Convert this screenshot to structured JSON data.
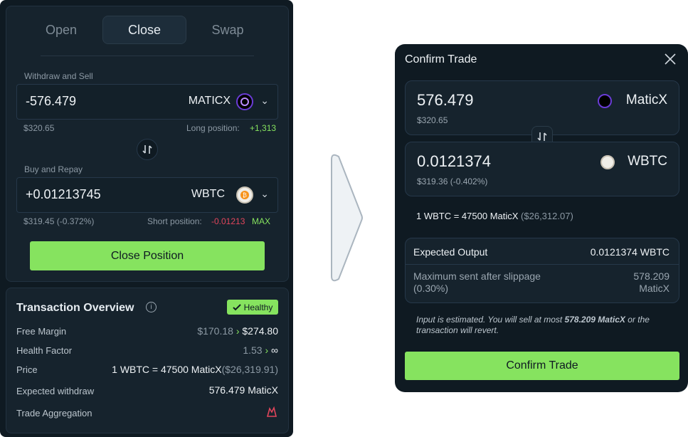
{
  "tabs": [
    "Open",
    "Close",
    "Swap"
  ],
  "withdraw": {
    "label": "Withdraw and Sell",
    "amount": "-576.479",
    "token": "MATICX",
    "usd": "$320.65",
    "position_label": "Long position:",
    "position_value": "+1,313"
  },
  "repay": {
    "label": "Buy and Repay",
    "amount": "+0.01213745",
    "token": "WBTC",
    "usd": "$319.45 (-0.372%)",
    "position_label": "Short position:",
    "position_value": "-0.01213",
    "max_label": "MAX"
  },
  "close_button": "Close Position",
  "overview": {
    "title": "Transaction Overview",
    "badge": "Healthy",
    "free_margin_label": "Free Margin",
    "free_margin_old": "$170.18",
    "free_margin_new": "$274.80",
    "health_label": "Health Factor",
    "health_old": "1.53",
    "health_new": "∞",
    "price_label": "Price",
    "price_value": "1 WBTC = 47500 MaticX",
    "price_usd": "($26,319.91)",
    "withdraw_label": "Expected withdraw",
    "withdraw_value": "576.479 MaticX",
    "aggregation_label": "Trade Aggregation"
  },
  "modal": {
    "title": "Confirm Trade",
    "from_amount": "576.479",
    "from_usd": "$320.65",
    "from_token": "MaticX",
    "to_amount": "0.0121374",
    "to_usd": "$319.36 (-0.402%)",
    "to_token": "WBTC",
    "rate": "1 WBTC = 47500 MaticX",
    "rate_usd": "($26,312.07)",
    "expected_label": "Expected Output",
    "expected_value": "0.0121374 WBTC",
    "max_sent_label": "Maximum sent after slippage (0.30%)",
    "max_sent_value": "578.209 MaticX",
    "note_prefix": "Input is estimated. You will sell at most ",
    "note_amount": "578.209 MaticX",
    "note_suffix": " or the transaction will revert.",
    "confirm_button": "Confirm Trade"
  },
  "colors": {
    "accent": "#86e35f",
    "negative": "#e0455b",
    "panel": "#0f1a22"
  }
}
